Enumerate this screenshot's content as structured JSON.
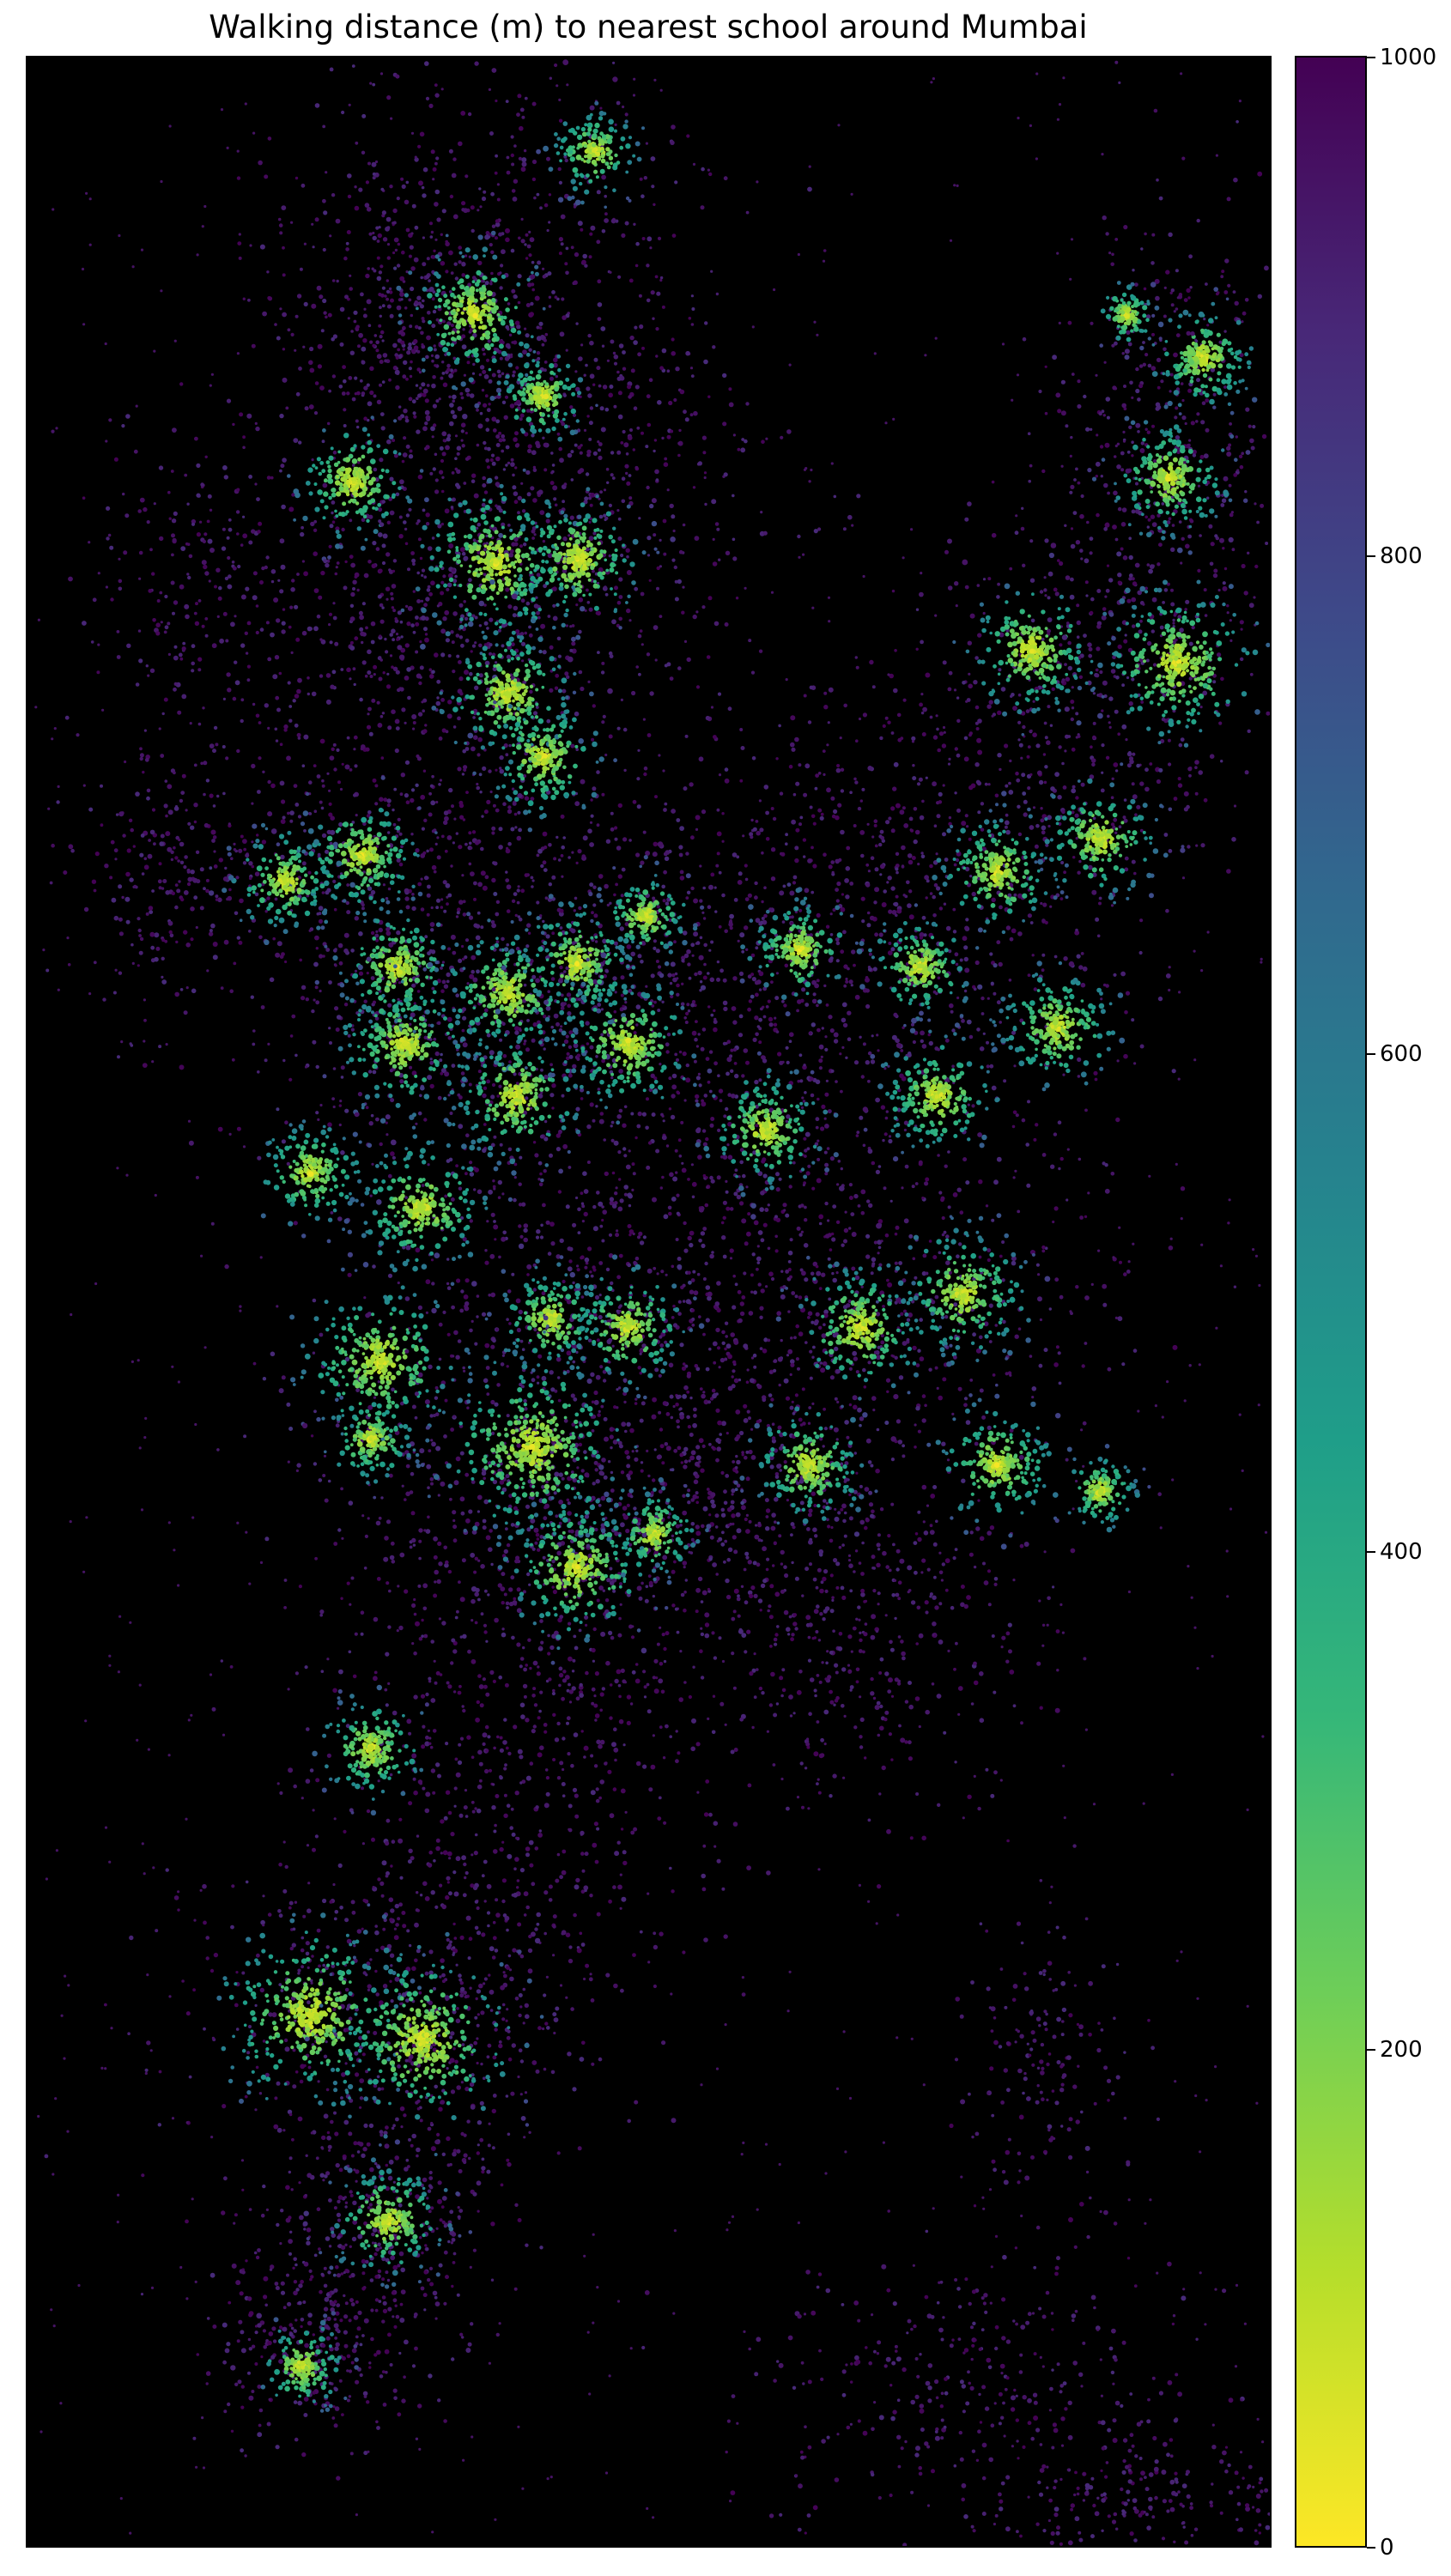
{
  "chart_data": {
    "type": "map",
    "title": "Walking distance (m) to nearest school around Mumbai",
    "background_color": "#000000",
    "colormap": "viridis_r",
    "colorbar": {
      "min": 0,
      "max": 1000,
      "ticks": [
        "0",
        "200",
        "400",
        "600",
        "800",
        "1000"
      ],
      "tick_values": [
        0,
        200,
        400,
        600,
        800,
        1000
      ]
    },
    "cmap_stops": [
      "#fde725",
      "#b5de2b",
      "#6ece58",
      "#35b779",
      "#1f9e89",
      "#26828e",
      "#31688e",
      "#3e4989",
      "#482878",
      "#440154"
    ]
  }
}
